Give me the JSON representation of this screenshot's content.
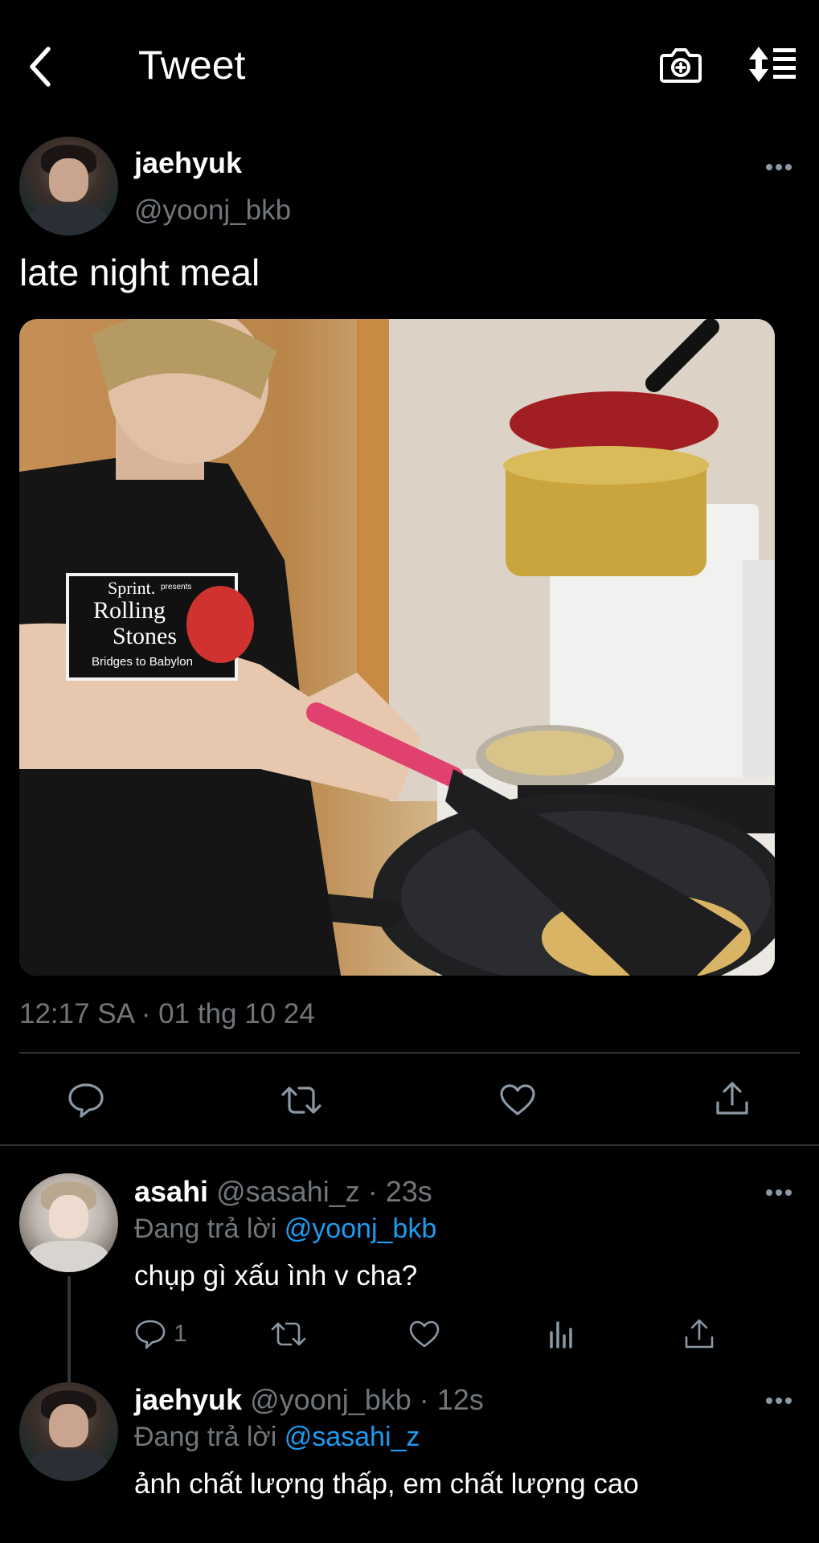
{
  "header": {
    "title": "Tweet",
    "back_icon": "chevron-left-icon",
    "camera_icon": "camera-plus-icon",
    "sort_icon": "sort-list-icon"
  },
  "tweet": {
    "author_name": "jaehyuk",
    "author_handle": "@yoonj_bkb",
    "text": "late night meal",
    "shirt_print": {
      "line1": "Sprint.",
      "line1b": "presents",
      "line2": "Rolling",
      "line3": "Stones",
      "line4": "Bridges to Babylon"
    },
    "timestamp": "12:17 SA · 01 thg 10 24",
    "actions": [
      "reply-icon",
      "retweet-icon",
      "like-icon",
      "share-icon"
    ]
  },
  "replies": [
    {
      "author_name": "asahi",
      "author_handle": "@sasahi_z",
      "time": "· 23s",
      "replying_prefix": "Đang trả lời",
      "replying_to": "@yoonj_bkb",
      "text": "chụp gì xấu ình v cha?",
      "reply_count": "1"
    },
    {
      "author_name": "jaehyuk",
      "author_handle": "@yoonj_bkb",
      "time": "· 12s",
      "replying_prefix": "Đang trả lời",
      "replying_to": "@sasahi_z",
      "text": "ảnh chất lượng thấp, em chất lượng cao"
    }
  ],
  "colors": {
    "background": "#000000",
    "text": "#e7e9ea",
    "muted": "#71767b",
    "link": "#1d9bf0",
    "divider": "#2f3336"
  }
}
